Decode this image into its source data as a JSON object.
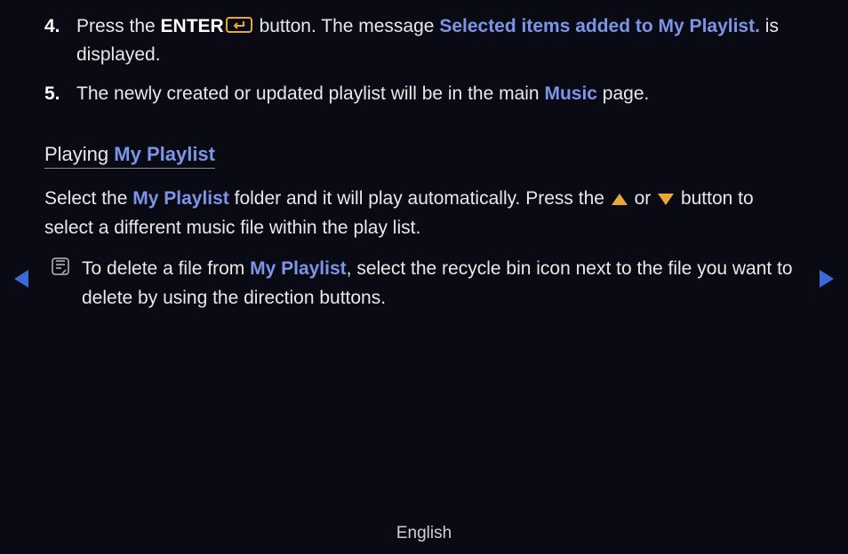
{
  "steps": {
    "item4": {
      "num": "4.",
      "t1": "Press the ",
      "enter": "ENTER",
      "t2": " button. The message ",
      "msg": "Selected items added to My Playlist.",
      "t3": " is displayed."
    },
    "item5": {
      "num": "5.",
      "t1": "The newly created or updated playlist will be in the main ",
      "music": "Music",
      "t2": " page."
    }
  },
  "section": {
    "t1": "Playing ",
    "hl": "My Playlist"
  },
  "para": {
    "t1": "Select the ",
    "hl1": "My Playlist",
    "t2": " folder and it will play automatically. Press the ",
    "t3": " or ",
    "t4": " button to select a different music file within the play list."
  },
  "note": {
    "t1": "To delete a file from ",
    "hl": "My Playlist",
    "t2": ", select the recycle bin icon next to the file you want to delete by using the direction buttons."
  },
  "footer": "English"
}
